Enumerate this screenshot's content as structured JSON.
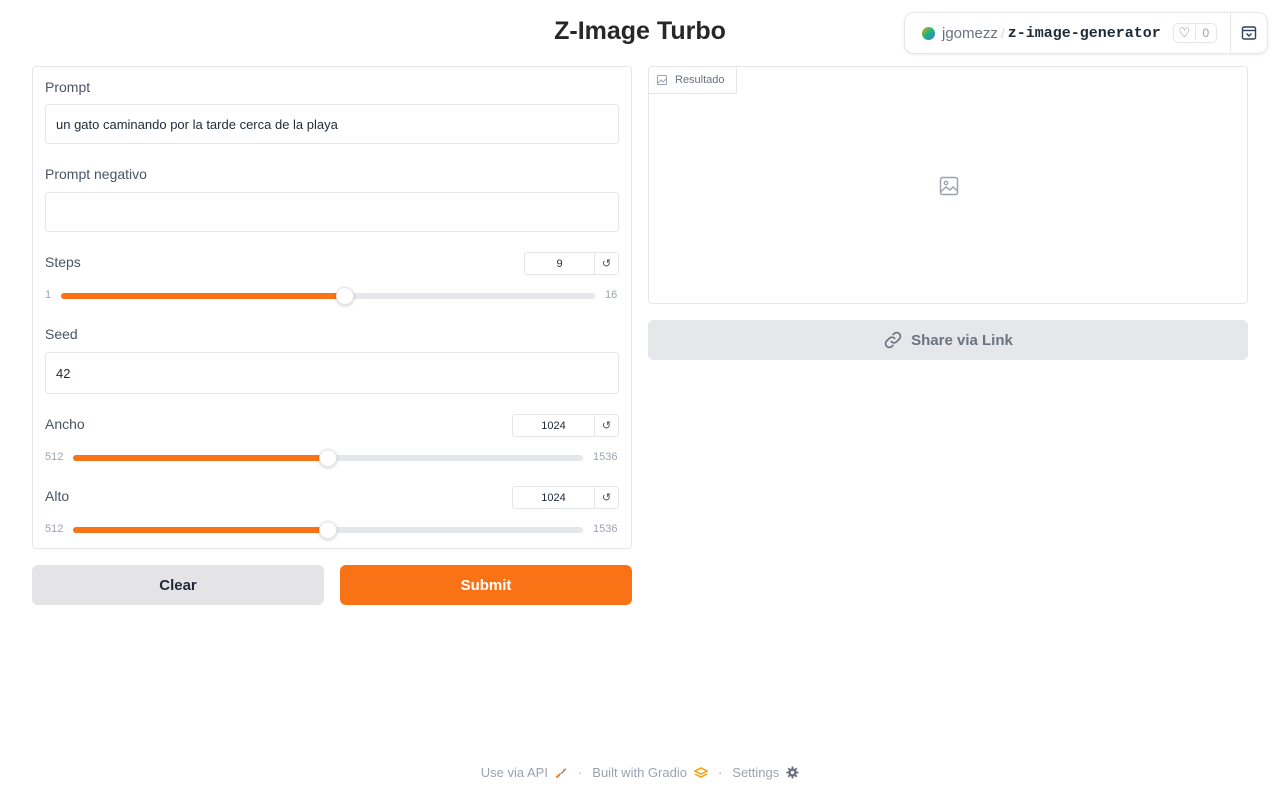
{
  "app": {
    "title": "Z-Image Turbo"
  },
  "hf_badge": {
    "owner": "jgomezz",
    "separator": "/",
    "repo": "z-image-generator",
    "likes": "0"
  },
  "form": {
    "prompt": {
      "label": "Prompt",
      "value": "un gato caminando por la tarde cerca de la playa"
    },
    "negative_prompt": {
      "label": "Prompt negativo",
      "value": ""
    },
    "steps": {
      "label": "Steps",
      "value": "9",
      "min": "1",
      "max": "16"
    },
    "seed": {
      "label": "Seed",
      "value": "42"
    },
    "width": {
      "label": "Ancho",
      "value": "1024",
      "min": "512",
      "max": "1536"
    },
    "height": {
      "label": "Alto",
      "value": "1024",
      "min": "512",
      "max": "1536"
    }
  },
  "buttons": {
    "clear": "Clear",
    "submit": "Submit",
    "share": "Share via Link"
  },
  "result": {
    "label": "Resultado"
  },
  "footer": {
    "api": "Use via API",
    "built": "Built with Gradio",
    "settings": "Settings",
    "sep": "·"
  },
  "colors": {
    "accent": "#f97316",
    "secondary_button": "#e4e4e7"
  }
}
